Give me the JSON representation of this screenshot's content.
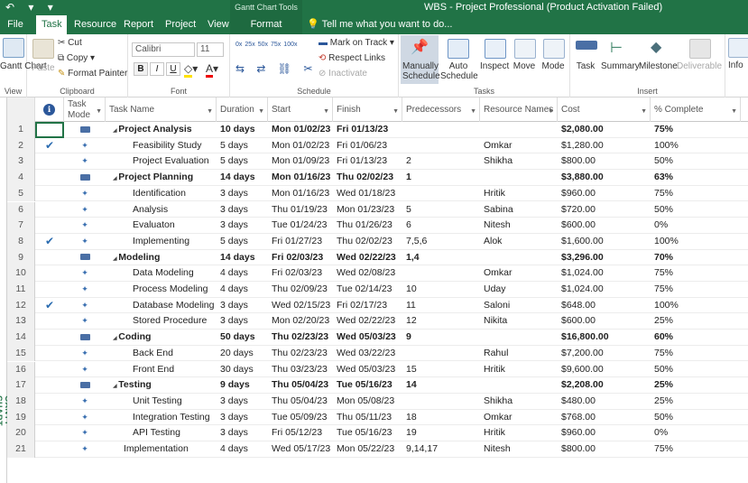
{
  "titlebar": {
    "qat": "↶ ▾ ▾",
    "context_title": "Gantt Chart Tools",
    "window_title": "WBS - Project Professional (Product Activation Failed)"
  },
  "tabs": [
    "File",
    "Task",
    "Resource",
    "Report",
    "Project",
    "View",
    "Format"
  ],
  "tell_me": "Tell me what you want to do...",
  "ribbon": {
    "gantt_chart": "Gantt Chart",
    "view_group": "View",
    "paste": "Paste",
    "cut": "Cut",
    "copy": "Copy",
    "format_painter": "Format Painter",
    "clipboard_group": "Clipboard",
    "font_name": "Calibri",
    "font_size": "11",
    "bold": "B",
    "italic": "I",
    "underline": "U",
    "font_group": "Font",
    "mark_on_track": "Mark on Track",
    "respect_links": "Respect Links",
    "inactivate": "Inactivate",
    "schedule_group": "Schedule",
    "manually_schedule": "Manually Schedule",
    "auto_schedule": "Auto Schedule",
    "inspect": "Inspect",
    "move": "Move",
    "mode": "Mode",
    "tasks_group": "Tasks",
    "task": "Task",
    "summary": "Summary",
    "milestone": "Milestone",
    "deliverable": "Deliverable",
    "insert_group": "Insert",
    "info": "Info",
    "pct_labels": [
      "0x",
      "25x",
      "50x",
      "75x",
      "100x"
    ]
  },
  "side_label": "GANTT CHART",
  "columns": {
    "info": "ℹ",
    "task_mode": "Task Mode",
    "task_name": "Task Name",
    "duration": "Duration",
    "start": "Start",
    "finish": "Finish",
    "predecessors": "Predecessors",
    "resource_names": "Resource Names",
    "cost": "Cost",
    "pct_complete": "% Complete"
  },
  "rows": [
    {
      "id": "1",
      "check": "",
      "summary": true,
      "indent": 0,
      "name": "Project Analysis",
      "duration": "10 days",
      "start": "Mon 01/02/23",
      "finish": "Fri 01/13/23",
      "pred": "",
      "res": "",
      "cost": "$2,080.00",
      "pct": "75%"
    },
    {
      "id": "2",
      "check": "✔",
      "summary": false,
      "indent": 1,
      "name": "Feasibility Study",
      "duration": "5 days",
      "start": "Mon 01/02/23",
      "finish": "Fri 01/06/23",
      "pred": "",
      "res": "Omkar",
      "cost": "$1,280.00",
      "pct": "100%"
    },
    {
      "id": "3",
      "check": "",
      "summary": false,
      "indent": 1,
      "name": "Project Evaluation",
      "duration": "5 days",
      "start": "Mon 01/09/23",
      "finish": "Fri 01/13/23",
      "pred": "2",
      "res": "Shikha",
      "cost": "$800.00",
      "pct": "50%"
    },
    {
      "id": "4",
      "check": "",
      "summary": true,
      "indent": 0,
      "name": "Project Planning",
      "duration": "14 days",
      "start": "Mon 01/16/23",
      "finish": "Thu 02/02/23",
      "pred": "1",
      "res": "",
      "cost": "$3,880.00",
      "pct": "63%"
    },
    {
      "id": "5",
      "check": "",
      "summary": false,
      "indent": 1,
      "name": "Identification",
      "duration": "3 days",
      "start": "Mon 01/16/23",
      "finish": "Wed 01/18/23",
      "pred": "",
      "res": "Hritik",
      "cost": "$960.00",
      "pct": "75%"
    },
    {
      "id": "6",
      "check": "",
      "summary": false,
      "indent": 1,
      "name": "Analysis",
      "duration": "3 days",
      "start": "Thu 01/19/23",
      "finish": "Mon 01/23/23",
      "pred": "5",
      "res": "Sabina",
      "cost": "$720.00",
      "pct": "50%"
    },
    {
      "id": "7",
      "check": "",
      "summary": false,
      "indent": 1,
      "name": "Evaluaton",
      "duration": "3 days",
      "start": "Tue 01/24/23",
      "finish": "Thu 01/26/23",
      "pred": "6",
      "res": "Nitesh",
      "cost": "$600.00",
      "pct": "0%"
    },
    {
      "id": "8",
      "check": "✔",
      "summary": false,
      "indent": 1,
      "name": "Implementing",
      "duration": "5 days",
      "start": "Fri 01/27/23",
      "finish": "Thu 02/02/23",
      "pred": "7,5,6",
      "res": "Alok",
      "cost": "$1,600.00",
      "pct": "100%"
    },
    {
      "id": "9",
      "check": "",
      "summary": true,
      "indent": 0,
      "name": "Modeling",
      "duration": "14 days",
      "start": "Fri 02/03/23",
      "finish": "Wed 02/22/23",
      "pred": "1,4",
      "res": "",
      "cost": "$3,296.00",
      "pct": "70%"
    },
    {
      "id": "10",
      "check": "",
      "summary": false,
      "indent": 1,
      "name": "Data Modeling",
      "duration": "4 days",
      "start": "Fri 02/03/23",
      "finish": "Wed 02/08/23",
      "pred": "",
      "res": "Omkar",
      "cost": "$1,024.00",
      "pct": "75%"
    },
    {
      "id": "11",
      "check": "",
      "summary": false,
      "indent": 1,
      "name": "Process Modeling",
      "duration": "4 days",
      "start": "Thu 02/09/23",
      "finish": "Tue 02/14/23",
      "pred": "10",
      "res": "Uday",
      "cost": "$1,024.00",
      "pct": "75%"
    },
    {
      "id": "12",
      "check": "✔",
      "summary": false,
      "indent": 1,
      "name": "Database Modeling",
      "duration": "3 days",
      "start": "Wed 02/15/23",
      "finish": "Fri 02/17/23",
      "pred": "11",
      "res": "Saloni",
      "cost": "$648.00",
      "pct": "100%"
    },
    {
      "id": "13",
      "check": "",
      "summary": false,
      "indent": 1,
      "name": "Stored Procedure",
      "duration": "3 days",
      "start": "Mon 02/20/23",
      "finish": "Wed 02/22/23",
      "pred": "12",
      "res": "Nikita",
      "cost": "$600.00",
      "pct": "25%"
    },
    {
      "id": "14",
      "check": "",
      "summary": true,
      "indent": 0,
      "name": "Coding",
      "duration": "50 days",
      "start": "Thu 02/23/23",
      "finish": "Wed 05/03/23",
      "pred": "9",
      "res": "",
      "cost": "$16,800.00",
      "pct": "60%"
    },
    {
      "id": "15",
      "check": "",
      "summary": false,
      "indent": 1,
      "name": "Back End",
      "duration": "20 days",
      "start": "Thu 02/23/23",
      "finish": "Wed 03/22/23",
      "pred": "",
      "res": "Rahul",
      "cost": "$7,200.00",
      "pct": "75%"
    },
    {
      "id": "16",
      "check": "",
      "summary": false,
      "indent": 1,
      "name": "Front End",
      "duration": "30 days",
      "start": "Thu 03/23/23",
      "finish": "Wed 05/03/23",
      "pred": "15",
      "res": "Hritik",
      "cost": "$9,600.00",
      "pct": "50%"
    },
    {
      "id": "17",
      "check": "",
      "summary": true,
      "indent": 0,
      "name": "Testing",
      "duration": "9 days",
      "start": "Thu 05/04/23",
      "finish": "Tue 05/16/23",
      "pred": "14",
      "res": "",
      "cost": "$2,208.00",
      "pct": "25%"
    },
    {
      "id": "18",
      "check": "",
      "summary": false,
      "indent": 1,
      "name": "Unit Testing",
      "duration": "3 days",
      "start": "Thu 05/04/23",
      "finish": "Mon 05/08/23",
      "pred": "",
      "res": "Shikha",
      "cost": "$480.00",
      "pct": "25%"
    },
    {
      "id": "19",
      "check": "",
      "summary": false,
      "indent": 1,
      "name": "Integration Testing",
      "duration": "3 days",
      "start": "Tue 05/09/23",
      "finish": "Thu 05/11/23",
      "pred": "18",
      "res": "Omkar",
      "cost": "$768.00",
      "pct": "50%"
    },
    {
      "id": "20",
      "check": "",
      "summary": false,
      "indent": 1,
      "name": "API Testing",
      "duration": "3 days",
      "start": "Fri 05/12/23",
      "finish": "Tue 05/16/23",
      "pred": "19",
      "res": "Hritik",
      "cost": "$960.00",
      "pct": "0%"
    },
    {
      "id": "21",
      "check": "",
      "summary": false,
      "indent": 0,
      "name": "Implementation",
      "duration": "4 days",
      "start": "Wed 05/17/23",
      "finish": "Mon 05/22/23",
      "pred": "9,14,17",
      "res": "Nitesh",
      "cost": "$800.00",
      "pct": "75%"
    }
  ]
}
